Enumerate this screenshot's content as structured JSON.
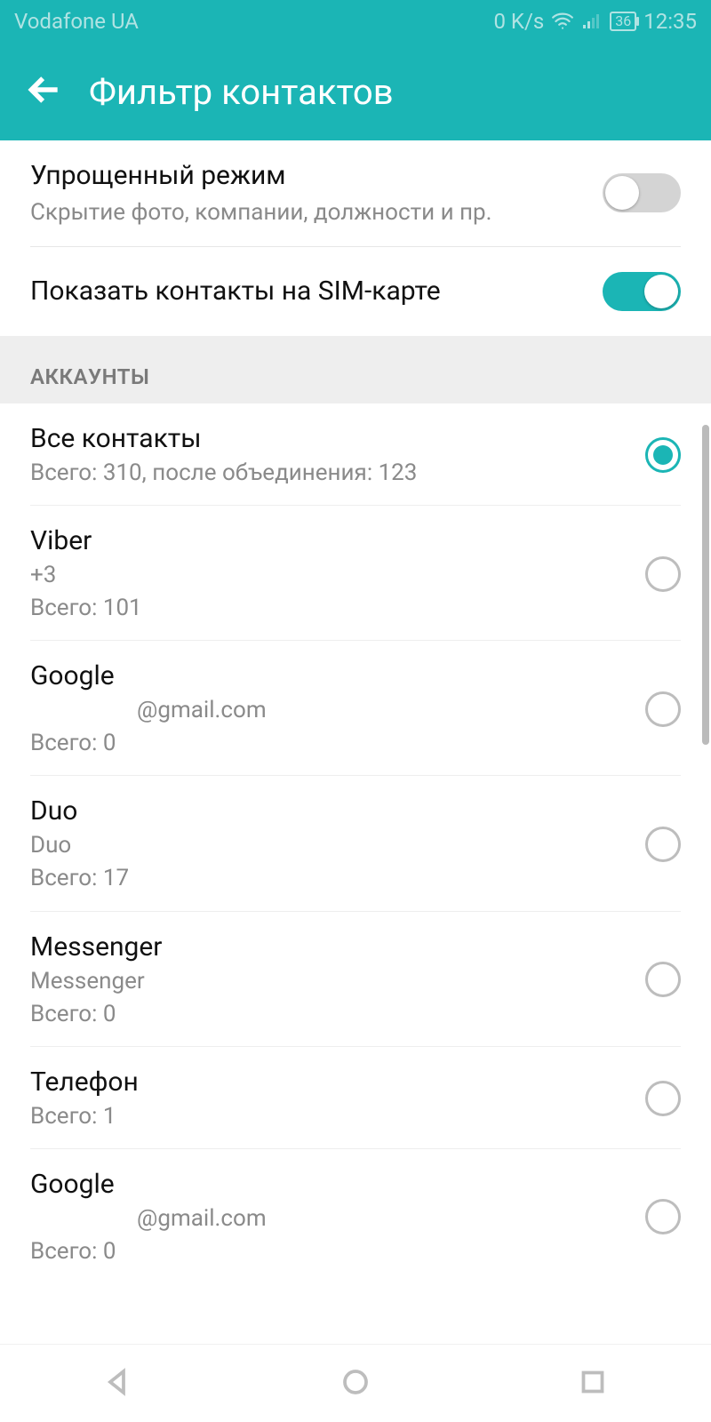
{
  "status": {
    "carrier": "Vodafone UA",
    "speed": "0 K/s",
    "battery": "36",
    "time": "12:35"
  },
  "appbar": {
    "title": "Фильтр контактов"
  },
  "settings": {
    "simpleMode": {
      "title": "Упрощенный режим",
      "subtitle": "Скрытие фото, компании, должности и пр.",
      "on": false
    },
    "showSim": {
      "title": "Показать контакты на SIM-карте",
      "on": true
    }
  },
  "sectionHeader": "АККАУНТЫ",
  "accounts": [
    {
      "title": "Все контакты",
      "lines": [
        "Всего: 310, после объединения: 123"
      ],
      "selected": true
    },
    {
      "title": "Viber",
      "lines": [
        "+3",
        "Всего: 101"
      ],
      "selected": false
    },
    {
      "title": "Google",
      "lines": [
        "@gmail.com",
        "Всего: 0"
      ],
      "selected": false,
      "emailRedactedPrefix": true
    },
    {
      "title": "Duo",
      "lines": [
        "Duo",
        "Всего: 17"
      ],
      "selected": false
    },
    {
      "title": "Messenger",
      "lines": [
        "Messenger",
        "Всего: 0"
      ],
      "selected": false
    },
    {
      "title": "Телефон",
      "lines": [
        "Всего: 1"
      ],
      "selected": false
    },
    {
      "title": "Google",
      "lines": [
        "@gmail.com",
        "Всего: 0"
      ],
      "selected": false,
      "emailRedactedPrefix": true
    }
  ],
  "colors": {
    "accent": "#1BB5B5"
  }
}
